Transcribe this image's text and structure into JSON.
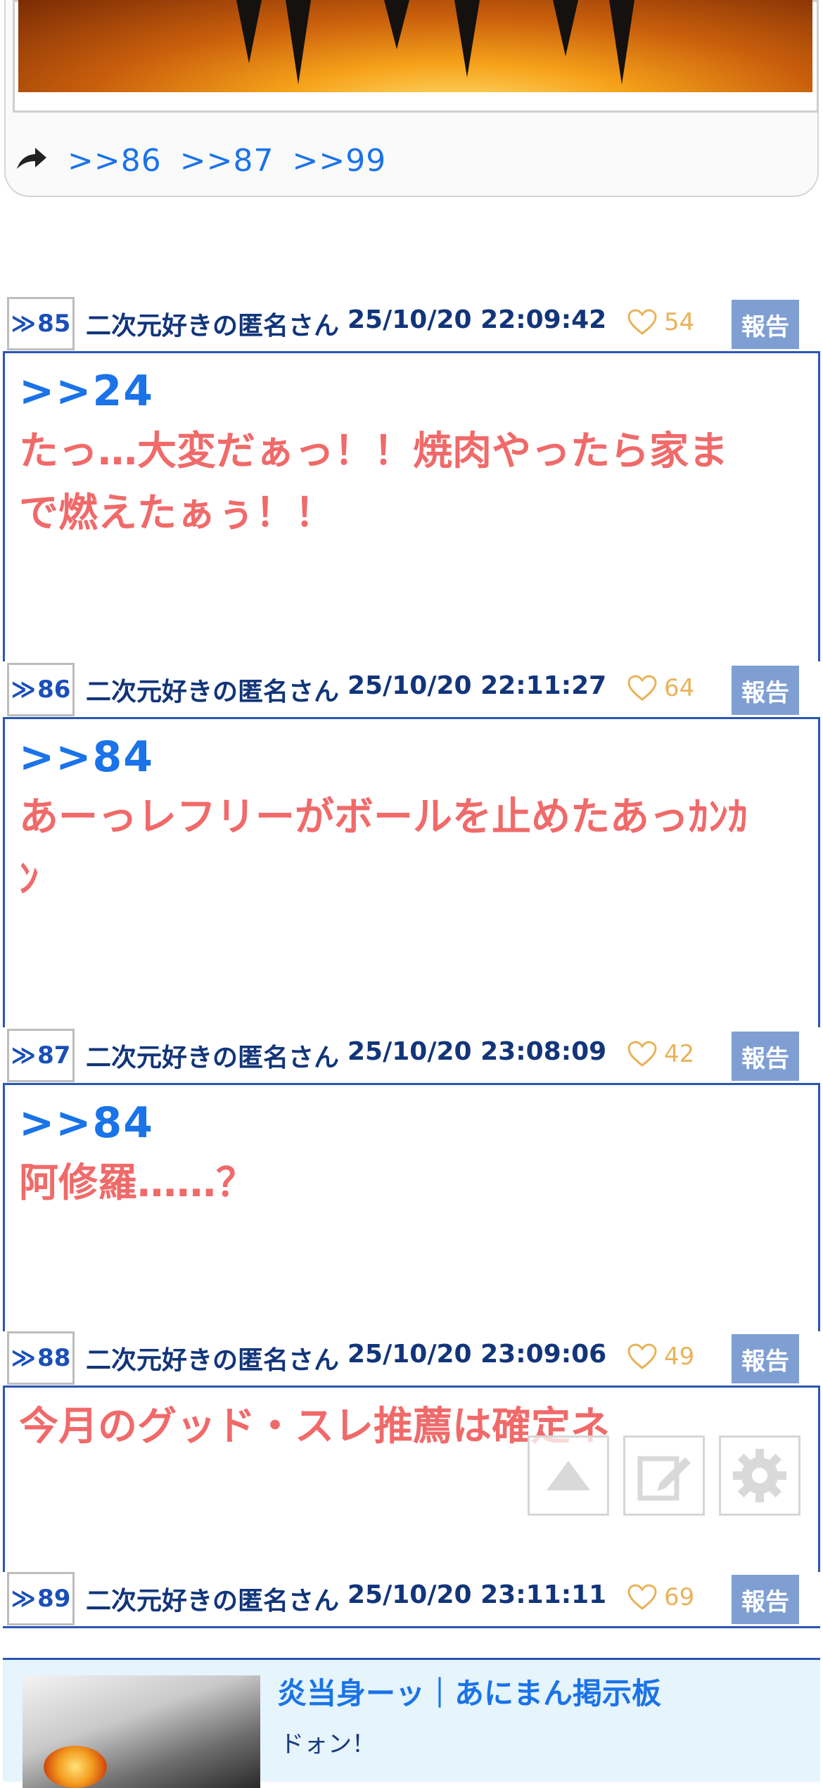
{
  "prev_post": {
    "reply_links": [
      ">>86",
      ">>87",
      ">>99"
    ]
  },
  "posts": [
    {
      "number": "85",
      "author": "二次元好きの匿名さん",
      "date": "25/10/20 22:09:42",
      "likes": "54",
      "report_label": "報告",
      "anchor": ">>24",
      "lines": [
        "たっ…大変だぁっ！！焼肉やったら家ま",
        "で燃えたぁぅ！！"
      ]
    },
    {
      "number": "86",
      "author": "二次元好きの匿名さん",
      "date": "25/10/20 22:11:27",
      "likes": "64",
      "report_label": "報告",
      "anchor": ">>84",
      "lines": [
        "あーっレフリーがボールを止めたあっｶﾝｶ",
        "ﾝ"
      ]
    },
    {
      "number": "87",
      "author": "二次元好きの匿名さん",
      "date": "25/10/20 23:08:09",
      "likes": "42",
      "report_label": "報告",
      "anchor": ">>84",
      "lines": [
        "阿修羅……？"
      ]
    },
    {
      "number": "88",
      "author": "二次元好きの匿名さん",
      "date": "25/10/20 23:09:06",
      "likes": "49",
      "report_label": "報告",
      "anchor": "",
      "lines": [
        "今月のグッド・スレ推薦は確定ネ"
      ]
    },
    {
      "number": "89",
      "author": "二次元好きの匿名さん",
      "date": "25/10/20 23:11:11",
      "likes": "69",
      "report_label": "報告"
    }
  ],
  "num_prefix": "≫",
  "related": {
    "title": "炎当身ーッ｜あにまん掲示板",
    "subtitle": "ドォン！"
  },
  "colors": {
    "accent_blue": "#1a73e8",
    "header_rule": "#2a56b3",
    "post_text": "#f06a6a",
    "like": "#e9b35a",
    "report_bg": "#7f9fd3"
  },
  "icons": [
    "reply-icon",
    "heart-icon",
    "scroll-top-icon",
    "edit-icon",
    "settings-gear-icon"
  ]
}
